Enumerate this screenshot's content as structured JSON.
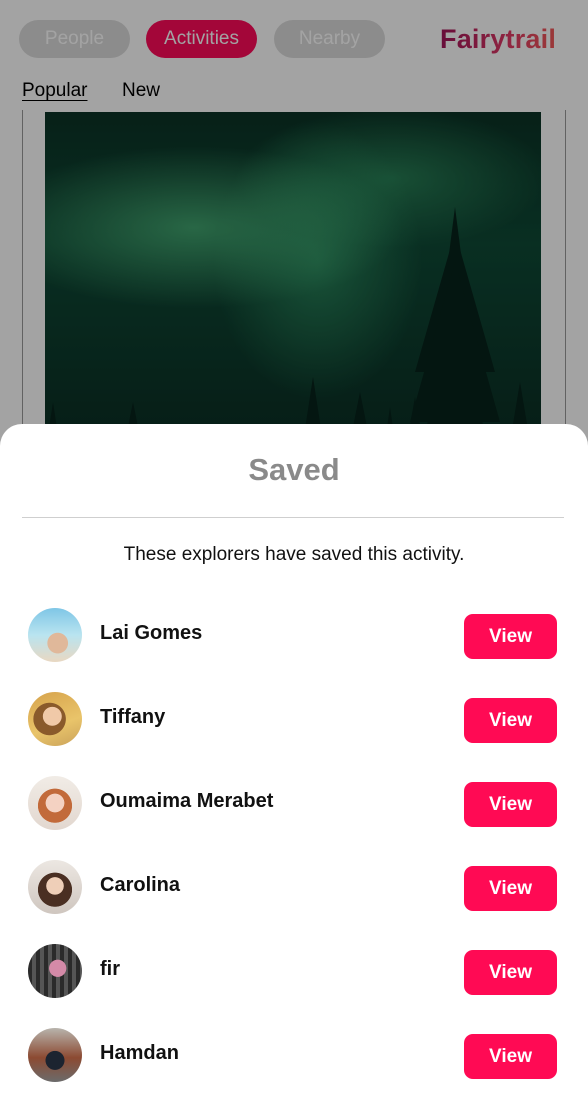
{
  "header": {
    "tabs": [
      {
        "label": "People",
        "active": false
      },
      {
        "label": "Activities",
        "active": true
      },
      {
        "label": "Nearby",
        "active": false
      }
    ],
    "logo_text": "Fairytrail"
  },
  "subtabs": [
    {
      "label": "Popular",
      "active": true
    },
    {
      "label": "New",
      "active": false
    }
  ],
  "sheet": {
    "title": "Saved",
    "description": "These explorers have saved this activity.",
    "explorers": [
      {
        "name": "Lai Gomes",
        "button": "View"
      },
      {
        "name": "Tiffany",
        "button": "View"
      },
      {
        "name": "Oumaima Merabet",
        "button": "View"
      },
      {
        "name": "Carolina",
        "button": "View"
      },
      {
        "name": "fir",
        "button": "View"
      },
      {
        "name": "Hamdan",
        "button": "View"
      }
    ]
  },
  "colors": {
    "accent": "#ff0a54",
    "title_gray": "#8a8a8a",
    "inactive_pill": "#dcdcdc"
  }
}
